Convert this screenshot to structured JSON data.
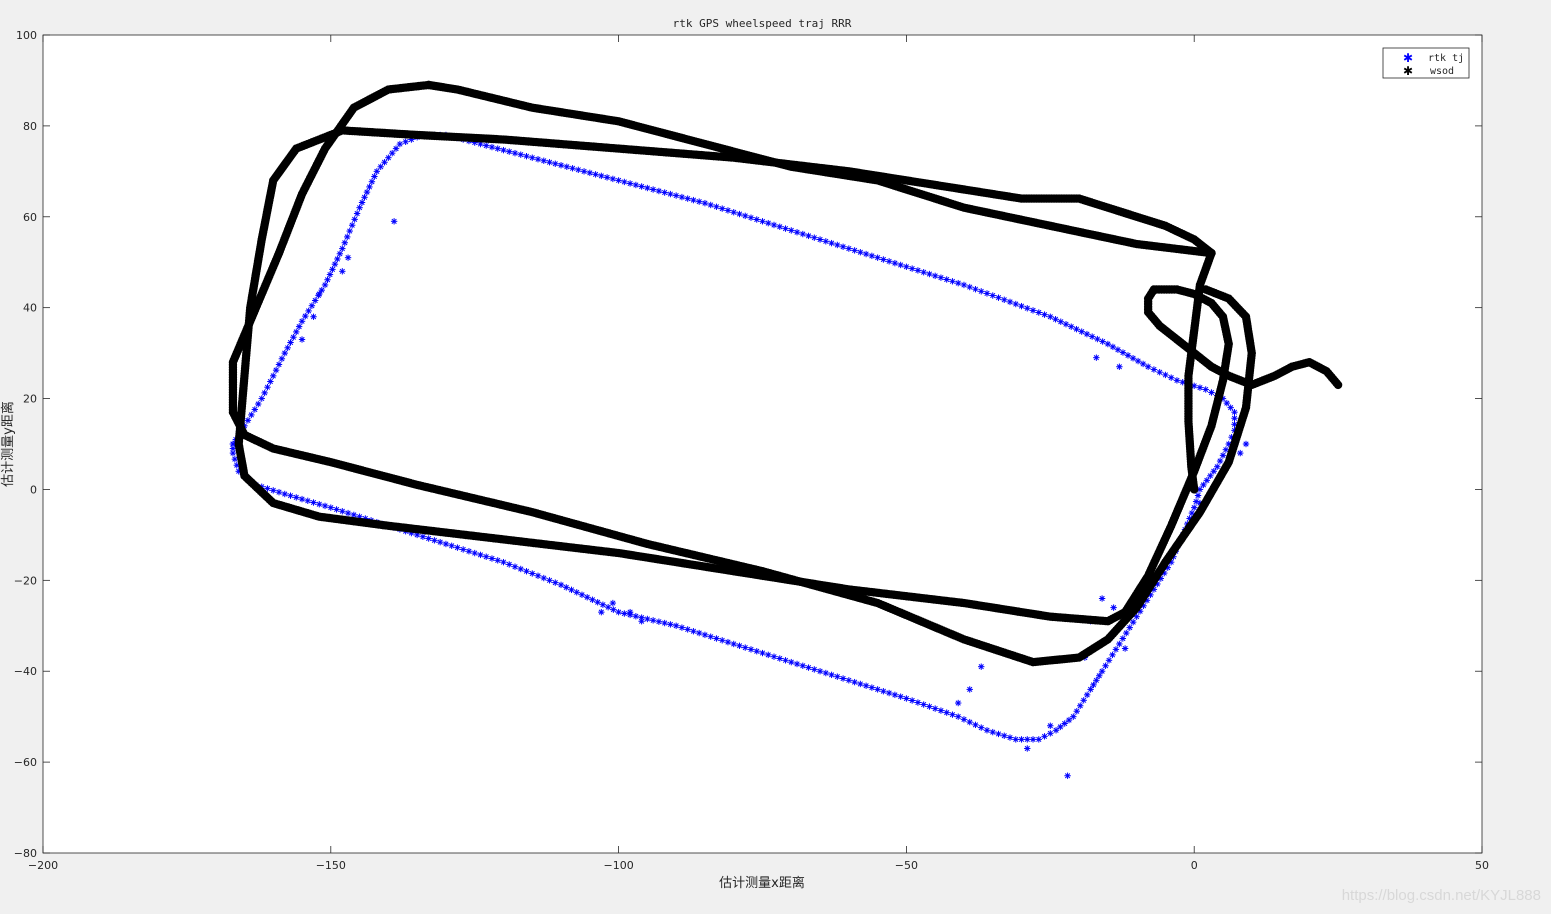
{
  "chart_data": {
    "type": "scatter",
    "title": "rtk GPS wheelspeed traj RRR",
    "xlabel": "估计测量x距离",
    "ylabel": "估计测量y距离",
    "xlim": [
      -200,
      50
    ],
    "ylim": [
      -80,
      100
    ],
    "xticks": [
      -200,
      -150,
      -100,
      -50,
      0,
      50
    ],
    "yticks": [
      -80,
      -60,
      -40,
      -20,
      0,
      20,
      40,
      60,
      80,
      100
    ],
    "grid": false,
    "legend_position": "top-right",
    "series": [
      {
        "name": "rtk tj",
        "marker": "*",
        "color": "#0000ff",
        "path": [
          [
            -167,
            10
          ],
          [
            -165,
            14
          ],
          [
            -162,
            20
          ],
          [
            -158,
            30
          ],
          [
            -155,
            37
          ],
          [
            -151,
            45
          ],
          [
            -148,
            53
          ],
          [
            -145,
            62
          ],
          [
            -142,
            70
          ],
          [
            -138,
            76
          ],
          [
            -134,
            78
          ],
          [
            -130,
            78
          ],
          [
            -115,
            73
          ],
          [
            -100,
            68
          ],
          [
            -85,
            63
          ],
          [
            -70,
            57
          ],
          [
            -55,
            51
          ],
          [
            -40,
            45
          ],
          [
            -25,
            38
          ],
          [
            -15,
            32
          ],
          [
            -8,
            27
          ],
          [
            -3,
            24
          ],
          [
            2,
            22
          ],
          [
            5,
            20
          ],
          [
            7,
            17
          ],
          [
            7,
            13
          ],
          [
            6,
            10
          ],
          [
            4,
            5
          ],
          [
            1,
            0
          ],
          [
            0,
            -4
          ],
          [
            -2,
            -10
          ],
          [
            -4,
            -16
          ],
          [
            -7,
            -22
          ],
          [
            -10,
            -28
          ],
          [
            -13,
            -34
          ],
          [
            -16,
            -40
          ],
          [
            -18,
            -44
          ],
          [
            -21,
            -50
          ],
          [
            -24,
            -53
          ],
          [
            -27,
            -55
          ],
          [
            -31,
            -55
          ],
          [
            -36,
            -53
          ],
          [
            -41,
            -50
          ],
          [
            -50,
            -46
          ],
          [
            -60,
            -42
          ],
          [
            -70,
            -38
          ],
          [
            -80,
            -34
          ],
          [
            -90,
            -30
          ],
          [
            -100,
            -27
          ],
          [
            -110,
            -21
          ],
          [
            -120,
            -16
          ],
          [
            -130,
            -12
          ],
          [
            -140,
            -8
          ],
          [
            -150,
            -4
          ],
          [
            -158,
            -1
          ],
          [
            -163,
            1
          ],
          [
            -166,
            4
          ],
          [
            -167,
            8
          ],
          [
            -167,
            10
          ]
        ],
        "outliers": [
          [
            -147,
            51
          ],
          [
            -148,
            48
          ],
          [
            -155,
            33
          ],
          [
            -153,
            38
          ],
          [
            -152,
            43
          ],
          [
            -139,
            59
          ],
          [
            -22,
            -63
          ],
          [
            -19,
            -37
          ],
          [
            -16,
            -24
          ],
          [
            -12,
            -35
          ],
          [
            -37,
            -39
          ],
          [
            -39,
            -44
          ],
          [
            -41,
            -47
          ],
          [
            -29,
            -57
          ],
          [
            -25,
            -52
          ],
          [
            -18,
            -29
          ],
          [
            -14,
            -26
          ],
          [
            -17,
            29
          ],
          [
            -13,
            27
          ],
          [
            8,
            8
          ],
          [
            9,
            10
          ],
          [
            7,
            11
          ],
          [
            1,
            -3
          ],
          [
            -96,
            -29
          ],
          [
            -98,
            -27
          ],
          [
            -103,
            -27
          ],
          [
            -101,
            -25
          ]
        ]
      },
      {
        "name": "wsod",
        "marker": "*",
        "color": "#000000",
        "path": [
          [
            0,
            0
          ],
          [
            -0.5,
            5
          ],
          [
            -1,
            15
          ],
          [
            -1,
            25
          ],
          [
            0,
            35
          ],
          [
            1,
            45
          ],
          [
            3,
            52
          ],
          [
            0,
            55
          ],
          [
            -5,
            58
          ],
          [
            -10,
            60
          ],
          [
            -20,
            64
          ],
          [
            -30,
            64
          ],
          [
            -40,
            66
          ],
          [
            -60,
            70
          ],
          [
            -80,
            73
          ],
          [
            -100,
            75
          ],
          [
            -120,
            77
          ],
          [
            -135,
            78
          ],
          [
            -148,
            79
          ],
          [
            -156,
            75
          ],
          [
            -160,
            68
          ],
          [
            -162,
            55
          ],
          [
            -164,
            40
          ],
          [
            -165,
            25
          ],
          [
            -166,
            10
          ],
          [
            -165,
            3
          ],
          [
            -160,
            -3
          ],
          [
            -152,
            -6
          ],
          [
            -140,
            -8
          ],
          [
            -120,
            -11
          ],
          [
            -100,
            -14
          ],
          [
            -80,
            -18
          ],
          [
            -60,
            -22
          ],
          [
            -40,
            -25
          ],
          [
            -25,
            -28
          ],
          [
            -15,
            -29
          ],
          [
            -12,
            -27
          ],
          [
            -8,
            -19
          ],
          [
            -4,
            -8
          ],
          [
            0,
            4
          ],
          [
            3,
            14
          ],
          [
            5,
            24
          ],
          [
            6,
            32
          ],
          [
            5,
            38
          ],
          [
            3,
            41
          ],
          [
            0,
            43
          ],
          [
            -3,
            44
          ],
          [
            -7,
            44
          ],
          [
            -8,
            42
          ],
          [
            -8,
            39
          ],
          [
            -6,
            36
          ],
          [
            -3,
            33
          ],
          [
            0,
            30
          ],
          [
            3,
            27
          ],
          [
            6,
            25
          ],
          [
            10,
            23
          ],
          [
            14,
            25
          ],
          [
            17,
            27
          ],
          [
            20,
            28
          ],
          [
            23,
            26
          ],
          [
            25,
            23
          ]
        ],
        "path_loop2": [
          [
            -133,
            89
          ],
          [
            -140,
            88
          ],
          [
            -146,
            84
          ],
          [
            -151,
            75
          ],
          [
            -155,
            65
          ],
          [
            -159,
            52
          ],
          [
            -163,
            40
          ],
          [
            -167,
            28
          ],
          [
            -167,
            17
          ],
          [
            -165,
            12
          ],
          [
            -160,
            9
          ],
          [
            -150,
            6
          ],
          [
            -135,
            1
          ],
          [
            -115,
            -5
          ],
          [
            -95,
            -12
          ],
          [
            -75,
            -18
          ],
          [
            -55,
            -25
          ],
          [
            -40,
            -33
          ],
          [
            -28,
            -38
          ],
          [
            -20,
            -37
          ],
          [
            -15,
            -33
          ],
          [
            -10,
            -26
          ],
          [
            -5,
            -16
          ],
          [
            1,
            -5
          ],
          [
            6,
            6
          ],
          [
            9,
            18
          ],
          [
            10,
            30
          ],
          [
            9,
            38
          ],
          [
            6,
            42
          ],
          [
            2,
            44
          ]
        ],
        "path_top2": [
          [
            -133,
            89
          ],
          [
            -128,
            88
          ],
          [
            -115,
            84
          ],
          [
            -100,
            81
          ],
          [
            -85,
            76
          ],
          [
            -70,
            71
          ],
          [
            -55,
            68
          ],
          [
            -40,
            62
          ],
          [
            -25,
            58
          ],
          [
            -10,
            54
          ],
          [
            3,
            52
          ]
        ]
      }
    ]
  },
  "watermark": "https://blog.csdn.net/KYJL888"
}
